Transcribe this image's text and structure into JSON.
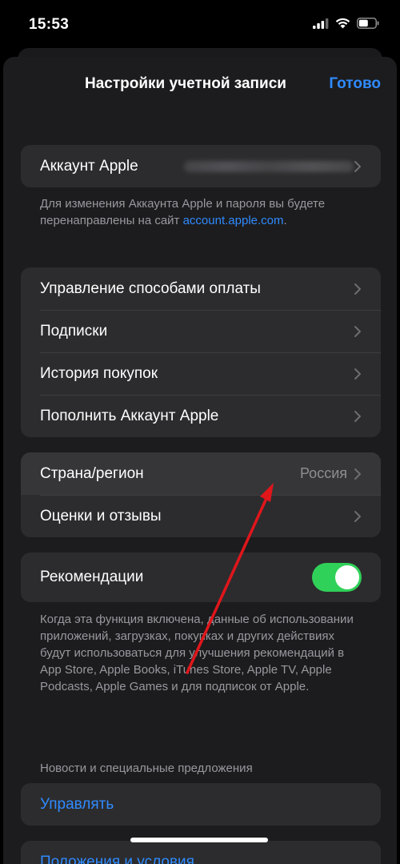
{
  "status_bar": {
    "time": "15:53"
  },
  "nav": {
    "title": "Настройки учетной записи",
    "done_label": "Готово"
  },
  "account_group": {
    "label": "Аккаунт Apple"
  },
  "account_note": {
    "text": "Для изменения Аккаунта Apple и пароля вы будете перенаправлены на сайт ",
    "link": "account.apple.com",
    "suffix": "."
  },
  "purchases_group": {
    "items": [
      {
        "label": "Управление способами оплаты"
      },
      {
        "label": "Подписки"
      },
      {
        "label": "История покупок"
      },
      {
        "label": "Пополнить Аккаунт Apple"
      }
    ]
  },
  "region_group": {
    "country_label": "Страна/регион",
    "country_value": "Россия",
    "ratings_label": "Оценки и отзывы"
  },
  "recommendations": {
    "label": "Рекомендации",
    "enabled": true,
    "note": "Когда эта функция включена, данные об использовании приложений, загрузках, покупках и других действиях будут использоваться для улучшения рекомендаций в App Store, Apple Books, iTunes Store, Apple TV, Apple Podcasts, Apple Games и для подписок от Apple."
  },
  "news_section": {
    "header": "Новости и специальные предложения",
    "manage_label": "Управлять"
  },
  "terms": {
    "label": "Положения и условия"
  },
  "colors": {
    "accent": "#2f8bff",
    "toggle_on": "#30d158",
    "annotation_arrow": "#e0161b"
  }
}
